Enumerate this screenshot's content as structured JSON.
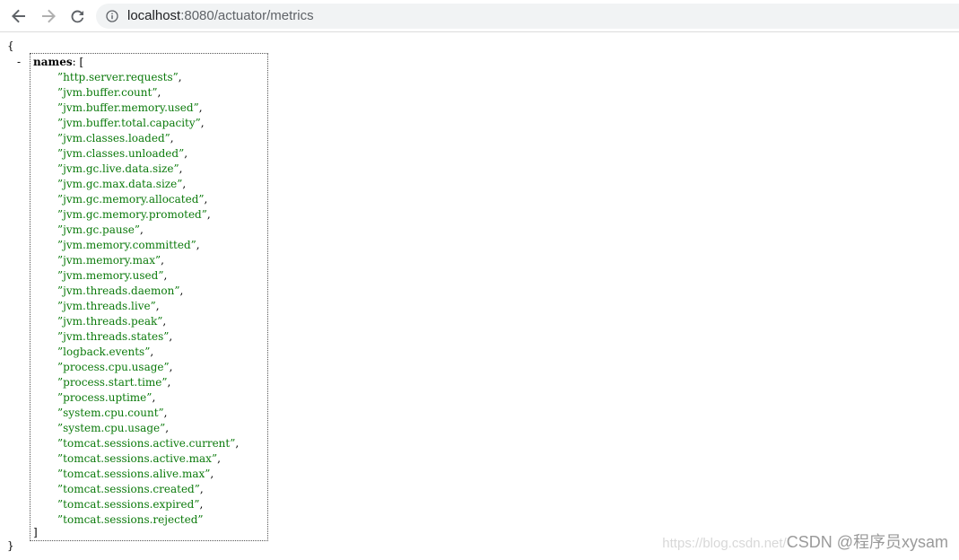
{
  "browser": {
    "url_host": "localhost",
    "url_rest": ":8080/actuator/metrics"
  },
  "json": {
    "open_brace": "{",
    "close_brace": "}",
    "collapse_symbol": "-",
    "key": "names",
    "key_suffix": ": [",
    "close_bracket": "]",
    "names": [
      "http.server.requests",
      "jvm.buffer.count",
      "jvm.buffer.memory.used",
      "jvm.buffer.total.capacity",
      "jvm.classes.loaded",
      "jvm.classes.unloaded",
      "jvm.gc.live.data.size",
      "jvm.gc.max.data.size",
      "jvm.gc.memory.allocated",
      "jvm.gc.memory.promoted",
      "jvm.gc.pause",
      "jvm.memory.committed",
      "jvm.memory.max",
      "jvm.memory.used",
      "jvm.threads.daemon",
      "jvm.threads.live",
      "jvm.threads.peak",
      "jvm.threads.states",
      "logback.events",
      "process.cpu.usage",
      "process.start.time",
      "process.uptime",
      "system.cpu.count",
      "system.cpu.usage",
      "tomcat.sessions.active.current",
      "tomcat.sessions.active.max",
      "tomcat.sessions.alive.max",
      "tomcat.sessions.created",
      "tomcat.sessions.expired",
      "tomcat.sessions.rejected"
    ]
  },
  "watermark": {
    "prefix": "https://blog.csdn.net/",
    "text": "CSDN @程序员xysam"
  },
  "icons": {
    "back": "arrow-left-icon",
    "forward": "arrow-right-icon",
    "reload": "reload-icon",
    "site_info": "info-circle-icon"
  },
  "colors": {
    "string": "#0b7a0b",
    "omnibox_bg": "#f1f3f4",
    "forward_disabled": "#b0b0b0",
    "icon": "#5f6368"
  }
}
